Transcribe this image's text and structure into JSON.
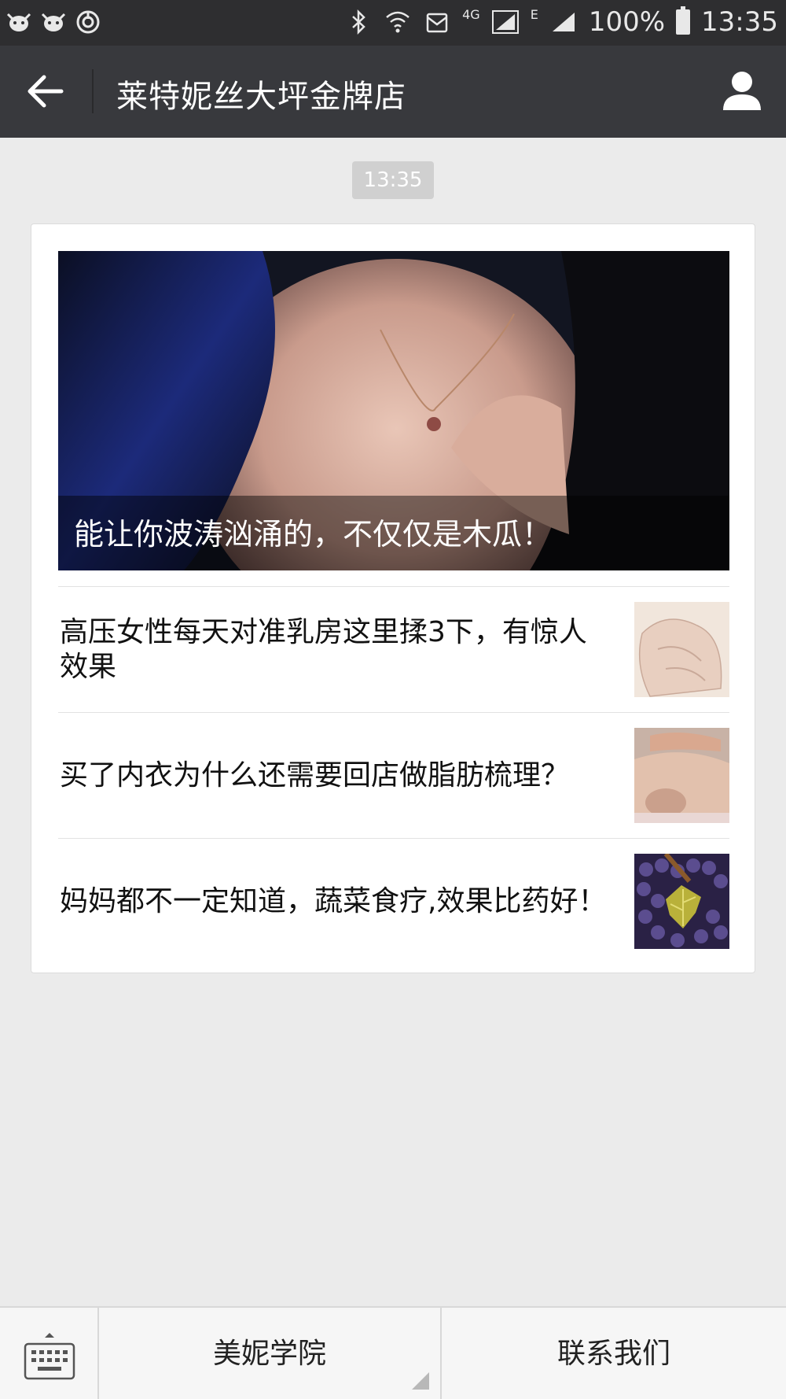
{
  "status_bar": {
    "time": "13:35",
    "battery": "100%",
    "network_4g": "4G",
    "network_e": "E",
    "left_icons": [
      "cow-icon",
      "cow-icon",
      "power-ring-icon"
    ],
    "right_icons": [
      "bluetooth-icon",
      "wifi-icon",
      "message-icon",
      "signal-icon",
      "signal-icon",
      "battery-icon"
    ]
  },
  "header": {
    "title": "莱特妮丝大坪金牌店",
    "back_icon": "arrow-left-icon",
    "profile_icon": "person-icon"
  },
  "chat": {
    "timestamp": "13:35"
  },
  "article_card": {
    "hero": {
      "caption": "能让你波涛汹涌的，不仅仅是木瓜！"
    },
    "items": [
      {
        "title": "高压女性每天对准乳房这里揉3下，有惊人效果"
      },
      {
        "title": "买了内衣为什么还需要回店做脂肪梳理？"
      },
      {
        "title": "妈妈都不一定知道，蔬菜食疗,效果比药好！"
      }
    ]
  },
  "bottom_menu": {
    "keyboard_icon": "keyboard-icon",
    "items": [
      {
        "label": "美妮学院"
      },
      {
        "label": "联系我们"
      }
    ]
  },
  "colors": {
    "status_bar": "#2e2e30",
    "title_bar": "#38393d",
    "background": "#ebebeb",
    "timestamp_bg": "#d0d0d0"
  }
}
